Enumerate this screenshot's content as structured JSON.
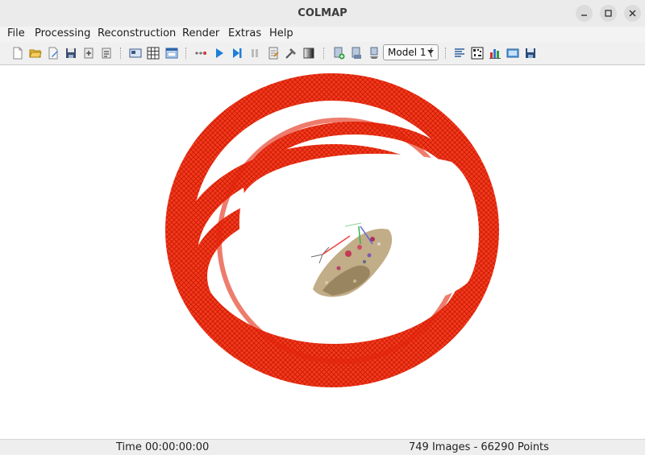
{
  "window": {
    "title": "COLMAP",
    "controls": [
      "minimize",
      "maximize",
      "close"
    ]
  },
  "menu": {
    "items": [
      "File",
      "Processing",
      "Reconstruction",
      "Render",
      "Extras",
      "Help"
    ]
  },
  "toolbar": {
    "icons": [
      "new-project-icon",
      "open-project-icon",
      "edit-project-icon",
      "save-project-icon",
      "import-model-icon",
      "export-model-icon",
      "feature-extraction-icon",
      "feature-matching-icon",
      "database-management-icon",
      "undistort-icon",
      "start-reconstruction-icon",
      "step-reconstruction-icon",
      "pause-reconstruction-icon",
      "bundle-adjustment-icon",
      "dense-reconstruction-icon",
      "render-toggle-icon",
      "add-model-icon",
      "reset-model-icon",
      "remove-model-icon",
      "model-stats-icon",
      "match-matrix-icon",
      "reconstruction-stats-icon",
      "screenshot-icon",
      "save-grab-icon"
    ],
    "model_select": {
      "value": "Model 1 ("
    }
  },
  "colors": {
    "camera_frustums": "#f22a10",
    "point_cloud": "#b69f72",
    "accent": "#1f7fd6"
  },
  "status": {
    "time": "Time 00:00:00:00",
    "summary": "749 Images - 66290 Points"
  }
}
